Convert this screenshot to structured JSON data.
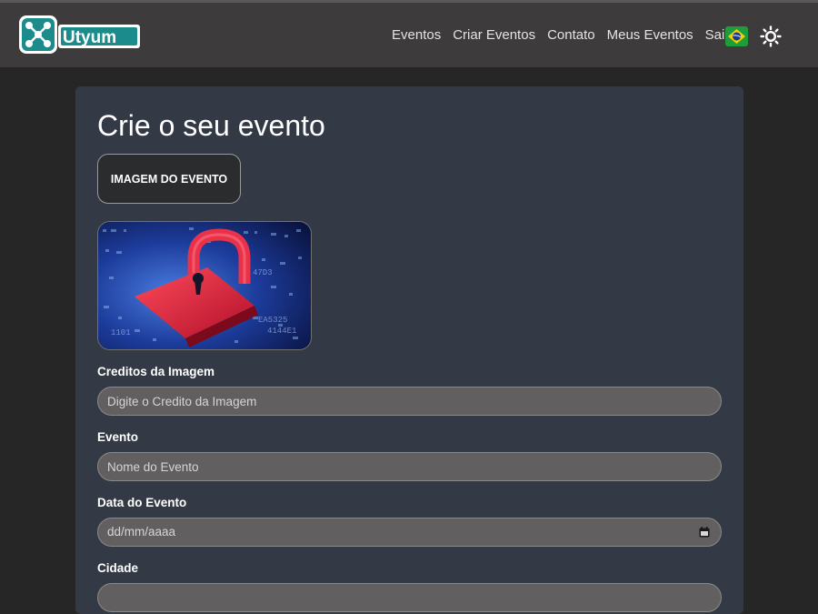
{
  "header": {
    "logo_text": "Utyum",
    "nav": [
      "Eventos",
      "Criar Eventos",
      "Contato",
      "Meus Eventos",
      "Sair"
    ],
    "flag_icon": "brazil-flag-icon",
    "theme_icon": "sun-icon"
  },
  "form": {
    "title": "Crie o seu evento",
    "image_button_label": "IMAGEM DO EVENTO",
    "credits_label": "Creditos da Imagem",
    "credits_placeholder": "Digite o Credito da Imagem",
    "event_label": "Evento",
    "event_placeholder": "Nome do Evento",
    "date_label": "Data do Evento",
    "date_placeholder": "dd/mm/aaaa",
    "city_label": "Cidade"
  },
  "colors": {
    "navbar": "#3d3b3b",
    "background": "#262626",
    "card": "#343a45",
    "input_bg": "#615f5f",
    "logo_teal": "#1b8b8b"
  }
}
